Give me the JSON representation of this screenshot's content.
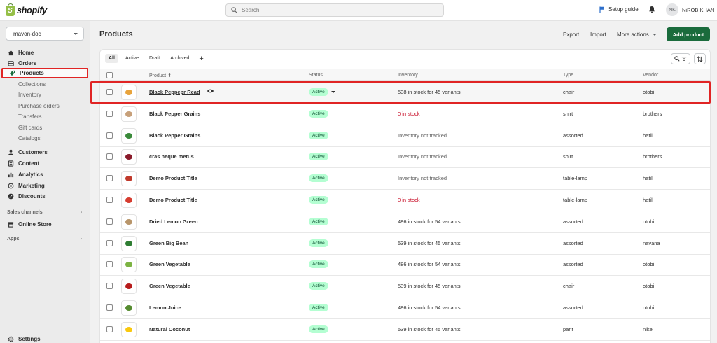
{
  "brand": {
    "name": "shopify",
    "bag_letter": "S",
    "color": "#95bf47"
  },
  "search": {
    "placeholder": "Search"
  },
  "topbar": {
    "setup_guide": "Setup guide",
    "user_initials": "NK",
    "user_name": "NiROB KHAN"
  },
  "store": {
    "name": "mavon-doc"
  },
  "sidebar": {
    "items": [
      {
        "label": "Home",
        "icon": "home-icon"
      },
      {
        "label": "Orders",
        "icon": "orders-icon"
      },
      {
        "label": "Products",
        "icon": "tag-icon",
        "active": true
      },
      {
        "label": "Customers",
        "icon": "person-icon"
      },
      {
        "label": "Content",
        "icon": "content-icon"
      },
      {
        "label": "Analytics",
        "icon": "bar-chart-icon"
      },
      {
        "label": "Marketing",
        "icon": "target-icon"
      },
      {
        "label": "Discounts",
        "icon": "discount-icon"
      }
    ],
    "product_subitems": [
      "Collections",
      "Inventory",
      "Purchase orders",
      "Transfers",
      "Gift cards",
      "Catalogs"
    ],
    "sales_channels_label": "Sales channels",
    "online_store": "Online Store",
    "apps_label": "Apps",
    "settings": "Settings"
  },
  "page": {
    "title": "Products",
    "export": "Export",
    "import": "Import",
    "more_actions": "More actions",
    "add_product": "Add product"
  },
  "tabs": [
    "All",
    "Active",
    "Draft",
    "Archived"
  ],
  "table": {
    "headers": {
      "product": "Product",
      "status": "Status",
      "inventory": "Inventory",
      "type": "Type",
      "vendor": "Vendor"
    },
    "rows": [
      {
        "name": "Black Peppepr Read",
        "status": "Active",
        "inventory": "538 in stock for 45 variants",
        "inv_state": "normal",
        "type": "chair",
        "vendor": "otobi",
        "thumb_color": "#e8a33b"
      },
      {
        "name": "Black Pepper Grains",
        "status": "Active",
        "inventory": "0 in stock",
        "inv_state": "out",
        "type": "shirt",
        "vendor": "brothers",
        "thumb_color": "#c7a07a"
      },
      {
        "name": "Black Pepper Grains",
        "status": "Active",
        "inventory": "Inventory not tracked",
        "inv_state": "untracked",
        "type": "assorted",
        "vendor": "hatil",
        "thumb_color": "#3a8a3a"
      },
      {
        "name": "cras neque metus",
        "status": "Active",
        "inventory": "Inventory not tracked",
        "inv_state": "untracked",
        "type": "shirt",
        "vendor": "brothers",
        "thumb_color": "#8a1a2a"
      },
      {
        "name": "Demo Product Title",
        "status": "Active",
        "inventory": "Inventory not tracked",
        "inv_state": "untracked",
        "type": "table-lamp",
        "vendor": "hatil",
        "thumb_color": "#c0392b"
      },
      {
        "name": "Demo Product Title",
        "status": "Active",
        "inventory": "0 in stock",
        "inv_state": "out",
        "type": "table-lamp",
        "vendor": "hatil",
        "thumb_color": "#d63c2f"
      },
      {
        "name": "Dried Lemon Green",
        "status": "Active",
        "inventory": "486 in stock for 54 variants",
        "inv_state": "normal",
        "type": "assorted",
        "vendor": "otobi",
        "thumb_color": "#b8956a"
      },
      {
        "name": "Green Big Bean",
        "status": "Active",
        "inventory": "539 in stock for 45 variants",
        "inv_state": "normal",
        "type": "assorted",
        "vendor": "navana",
        "thumb_color": "#2e7d32"
      },
      {
        "name": "Green Vegetable",
        "status": "Active",
        "inventory": "486 in stock for 54 variants",
        "inv_state": "normal",
        "type": "assorted",
        "vendor": "otobi",
        "thumb_color": "#7cb342"
      },
      {
        "name": "Green Vegetable",
        "status": "Active",
        "inventory": "539 in stock for 45 variants",
        "inv_state": "normal",
        "type": "chair",
        "vendor": "otobi",
        "thumb_color": "#b71c1c"
      },
      {
        "name": "Lemon Juice",
        "status": "Active",
        "inventory": "486 in stock for 54 variants",
        "inv_state": "normal",
        "type": "assorted",
        "vendor": "otobi",
        "thumb_color": "#558b2f"
      },
      {
        "name": "Natural Coconut",
        "status": "Active",
        "inventory": "539 in stock for 45 variants",
        "inv_state": "normal",
        "type": "pant",
        "vendor": "nike",
        "thumb_color": "#f9c80e"
      }
    ]
  },
  "colors": {
    "primary_button": "#1a6b3c",
    "active_badge_bg": "#b4fed2",
    "out_of_stock": "#c70a24",
    "highlight_outline": "#e02424"
  }
}
